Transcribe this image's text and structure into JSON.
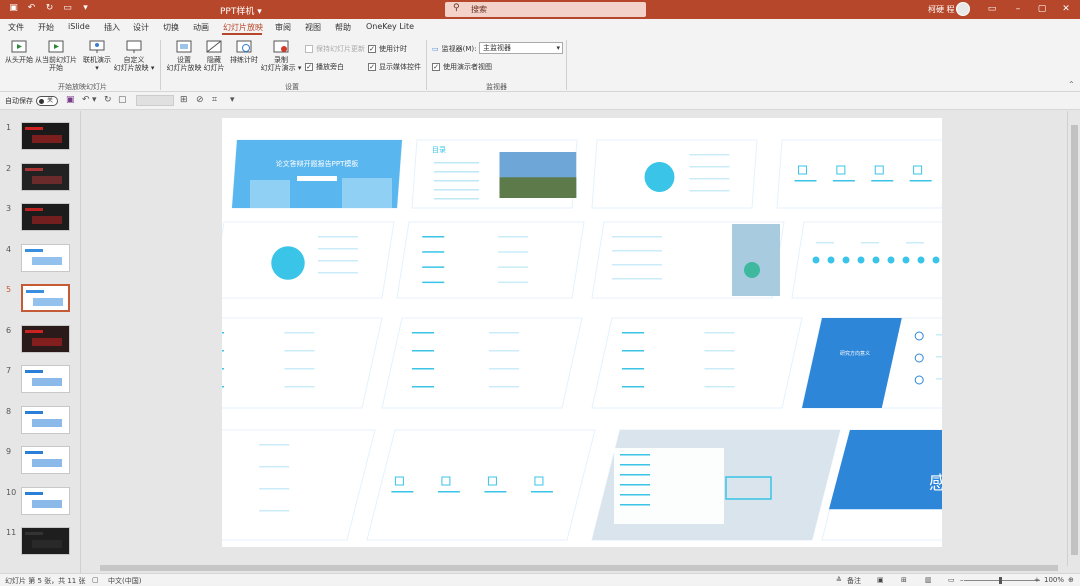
{
  "titlebar": {
    "doc_title": "PPT样机  ▾",
    "search_placeholder": "搜索",
    "user": "柯硬 程"
  },
  "menu": {
    "tabs": [
      "文件",
      "开始",
      "iSlide",
      "插入",
      "设计",
      "切换",
      "动画",
      "幻灯片放映",
      "审阅",
      "视图",
      "帮助",
      "OneKey Lite"
    ],
    "active_index": 7,
    "share": "共享",
    "comments": "批注"
  },
  "ribbon": {
    "from_start": "从头开始",
    "from_current_1": "从当前幻灯片",
    "from_current_2": "开始",
    "online_1": "联机演示",
    "online_2": "▾",
    "custom_1": "自定义",
    "custom_2": "幻灯片放映 ▾",
    "group_start": "开始放映幻灯片",
    "setup_1": "设置",
    "setup_2": "幻灯片放映",
    "hide_1": "隐藏",
    "hide_2": "幻灯片",
    "rehearse": "排练计时",
    "record_1": "录制",
    "record_2": "幻灯片演示 ▾",
    "keep_updated": "保持幻灯片更新",
    "use_timing": "使用计时",
    "play_narration": "播放旁白",
    "show_media": "显示媒体控件",
    "group_setup": "设置",
    "monitor_label": "监视器(M):",
    "monitor_value": "主监视器",
    "presenter_view": "使用演示者视图",
    "group_monitor": "监视器"
  },
  "qat": {
    "autosave": "自动保存",
    "toggle": "关"
  },
  "thumbnails": [
    {
      "num": "1",
      "bg": "#1a1a1a",
      "accent": "#cc2222"
    },
    {
      "num": "2",
      "bg": "#222222",
      "accent": "#aa3333"
    },
    {
      "num": "3",
      "bg": "#1c1c1c",
      "accent": "#bb2222"
    },
    {
      "num": "4",
      "bg": "#ffffff",
      "accent": "#3a8ee0"
    },
    {
      "num": "5",
      "bg": "#ffffff",
      "accent": "#3a8ee0"
    },
    {
      "num": "6",
      "bg": "#2a1a1a",
      "accent": "#cc2222"
    },
    {
      "num": "7",
      "bg": "#ffffff",
      "accent": "#2a7fd8"
    },
    {
      "num": "8",
      "bg": "#ffffff",
      "accent": "#2a7fd8"
    },
    {
      "num": "9",
      "bg": "#ffffff",
      "accent": "#2a7fd8"
    },
    {
      "num": "10",
      "bg": "#ffffff",
      "accent": "#2a7fd8"
    },
    {
      "num": "11",
      "bg": "#1e1e1e",
      "accent": "#333333"
    }
  ],
  "selected_thumb": "5",
  "tiles": [
    {
      "title": "论文答辩开题报告PPT模板",
      "kind": "cover"
    },
    {
      "title": "目录",
      "kind": "photo"
    },
    {
      "title": "",
      "kind": "circle"
    },
    {
      "title": "",
      "kind": "icons"
    },
    {
      "title": "",
      "kind": "circle"
    },
    {
      "title": "",
      "kind": "lines"
    },
    {
      "title": "",
      "kind": "photo-right"
    },
    {
      "title": "",
      "kind": "dots"
    },
    {
      "title": "",
      "kind": "lines"
    },
    {
      "title": "",
      "kind": "lines"
    },
    {
      "title": "",
      "kind": "lines"
    },
    {
      "title": "研究方向意义",
      "kind": "split"
    },
    {
      "title": "",
      "kind": "lines"
    },
    {
      "title": "",
      "kind": "icons"
    },
    {
      "title": "",
      "kind": "photo-book"
    },
    {
      "title": "感谢倾听",
      "kind": "thanks"
    }
  ],
  "status": {
    "slide_info": "幻灯片 第 5 张，共 11 张",
    "language": "中文(中国)",
    "notes": "备注",
    "zoom": "100%"
  },
  "colors": {
    "accent": "#b7472a",
    "slide_blue": "#2e86d9",
    "cyan": "#39c4e8"
  }
}
